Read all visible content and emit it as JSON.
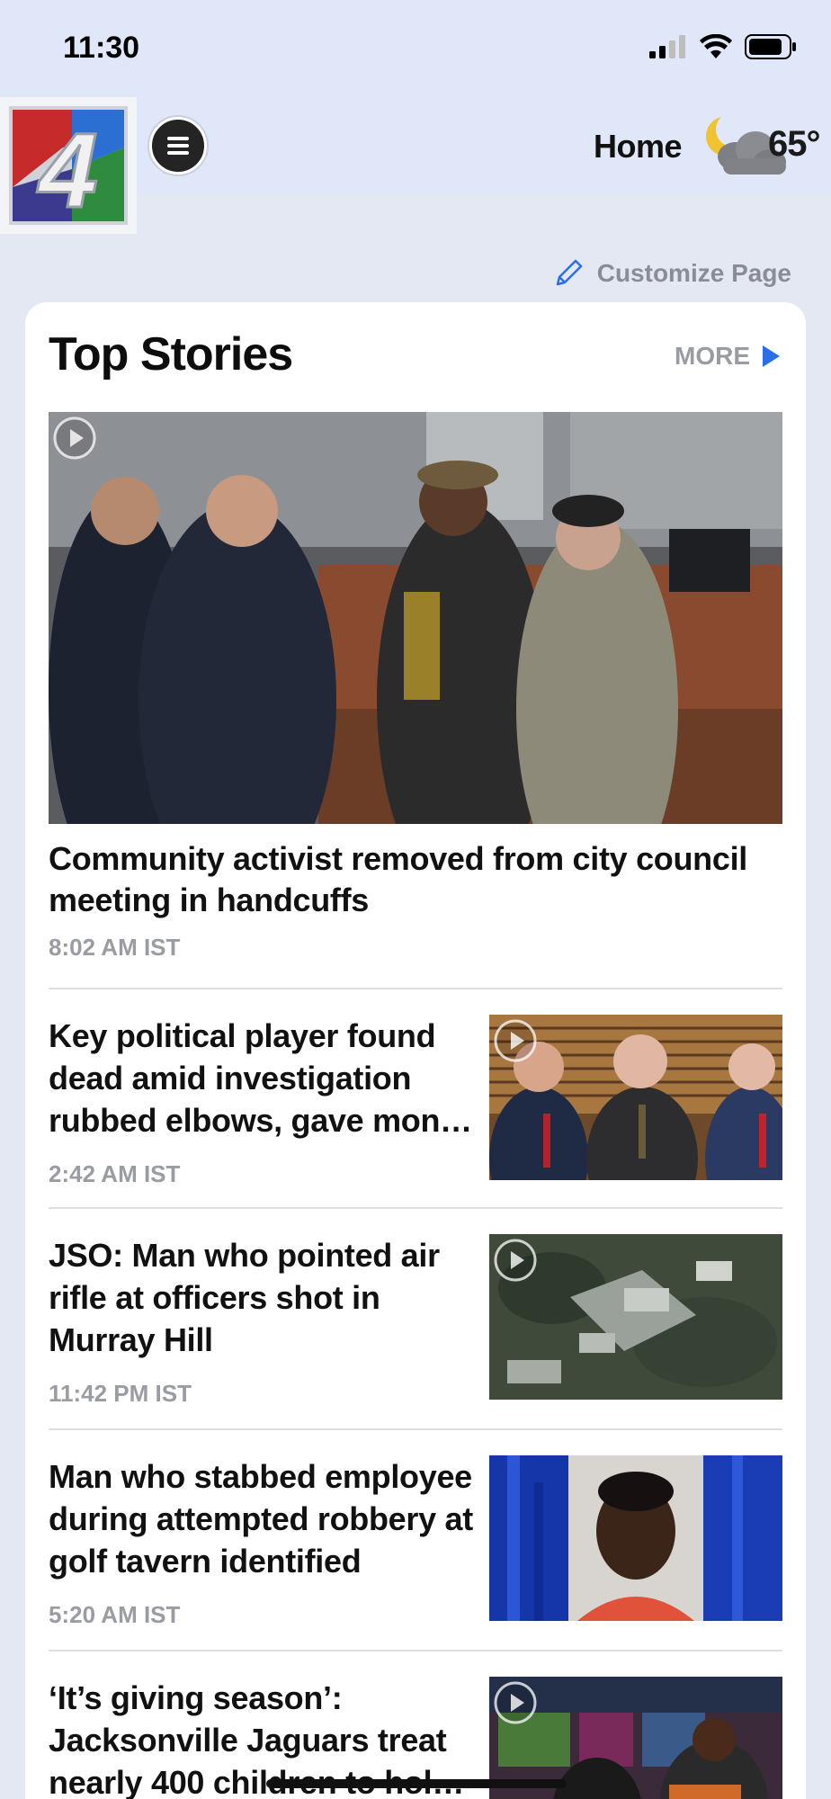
{
  "status_bar": {
    "time": "11:30"
  },
  "header": {
    "logo_text": "4",
    "home_label": "Home",
    "temperature": "65°",
    "weather_icon": "partly-cloudy-night-icon"
  },
  "customize": {
    "label": "Customize Page"
  },
  "top_stories": {
    "title": "Top Stories",
    "more_label": "MORE",
    "hero": {
      "title": "Community activist removed from city council meeting in handcuffs",
      "time": "8:02 AM IST"
    },
    "stories": [
      {
        "title": "Key political player found dead amid investigation rubbed elbows, gave mon…",
        "time": "2:42 AM IST"
      },
      {
        "title": "JSO: Man who pointed air rifle at officers shot in Murray Hill",
        "time": "11:42 PM IST"
      },
      {
        "title": "Man who stabbed employee during attempted robbery at golf tavern identified",
        "time": "5:20 AM IST"
      },
      {
        "title": "‘It’s giving season’: Jacksonville Jaguars treat nearly 400 children to hol…",
        "time": ""
      }
    ]
  },
  "colors": {
    "accent": "#2b6fe8",
    "muted": "#9a9ca3",
    "header_bg": "#dfe7f8",
    "page_bg": "#e3e8f3"
  }
}
